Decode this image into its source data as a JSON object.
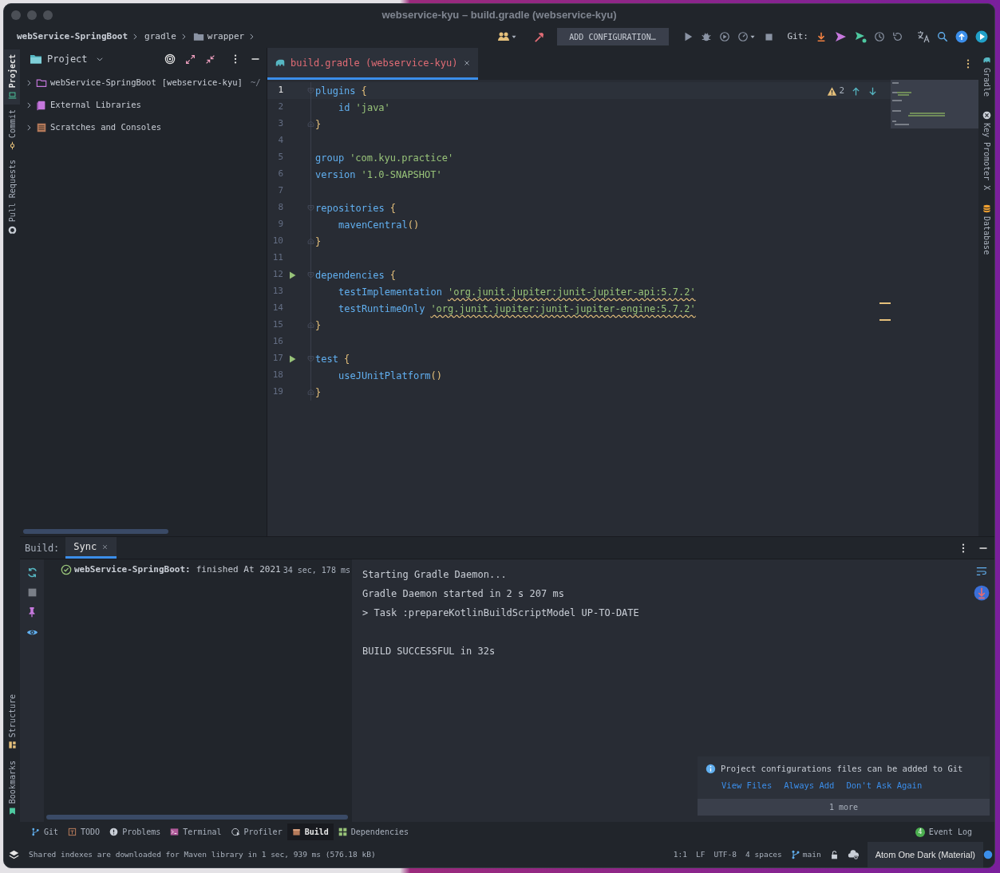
{
  "window": {
    "title": "webservice-kyu – build.gradle (webservice-kyu)"
  },
  "breadcrumbs": [
    {
      "label": "webService-SpringBoot",
      "kind": "project"
    },
    {
      "label": "gradle",
      "kind": "plain"
    },
    {
      "label": "wrapper",
      "kind": "folder"
    }
  ],
  "toolbar": {
    "run_configuration": "ADD CONFIGURATION…",
    "git_label": "Git:"
  },
  "left_stripe": [
    {
      "label": "Project",
      "selected": true
    },
    {
      "label": "Commit",
      "selected": false
    },
    {
      "label": "Pull Requests",
      "selected": false
    }
  ],
  "left_stripe_bottom": [
    {
      "label": "Structure"
    },
    {
      "label": "Bookmarks"
    }
  ],
  "right_stripe": [
    {
      "label": "Gradle"
    },
    {
      "label": "Key Promoter X"
    },
    {
      "label": "Database"
    }
  ],
  "project_panel": {
    "title": "Project",
    "items": [
      {
        "label": "webService-SpringBoot",
        "module": "[webservice-kyu]",
        "path": "~/",
        "kind": "module",
        "expanded": false
      },
      {
        "label": "External Libraries",
        "kind": "libraries",
        "expanded": false
      },
      {
        "label": "Scratches and Consoles",
        "kind": "scratches",
        "expanded": false
      }
    ]
  },
  "editor": {
    "tabs": [
      {
        "label": "build.gradle (webservice-kyu)",
        "selected": true
      }
    ],
    "warning_count": "2",
    "lines": [
      {
        "number": "1",
        "current": true,
        "run": false,
        "fold_start": true,
        "fold_end": false,
        "indented": false,
        "tokens": [
          {
            "kind": "ident",
            "text": "plugins"
          },
          {
            "kind": "brace",
            "text": "{"
          }
        ]
      },
      {
        "number": "2",
        "current": false,
        "run": false,
        "fold_start": false,
        "fold_end": false,
        "indented": true,
        "tokens": [
          {
            "kind": "ident",
            "text": "id"
          },
          {
            "kind": "string",
            "text": "'java'"
          }
        ]
      },
      {
        "number": "3",
        "current": false,
        "run": false,
        "fold_start": false,
        "fold_end": true,
        "indented": false,
        "tokens": [
          {
            "kind": "brace",
            "text": "}"
          }
        ]
      },
      {
        "number": "4",
        "current": false,
        "run": false,
        "fold_start": false,
        "fold_end": false
      },
      {
        "number": "5",
        "current": false,
        "run": false,
        "fold_start": false,
        "fold_end": false,
        "indented": false,
        "tokens": [
          {
            "kind": "ident",
            "text": "group"
          },
          {
            "kind": "string",
            "text": "'com.kyu.practice'"
          }
        ]
      },
      {
        "number": "6",
        "current": false,
        "run": false,
        "fold_start": false,
        "fold_end": false,
        "indented": false,
        "tokens": [
          {
            "kind": "ident",
            "text": "version"
          },
          {
            "kind": "string",
            "text": "'1.0-SNAPSHOT'"
          }
        ]
      },
      {
        "number": "7",
        "current": false,
        "run": false,
        "fold_start": false,
        "fold_end": false
      },
      {
        "number": "8",
        "current": false,
        "run": false,
        "fold_start": true,
        "fold_end": false,
        "indented": false,
        "tokens": [
          {
            "kind": "ident",
            "text": "repositories"
          },
          {
            "kind": "brace",
            "text": "{"
          }
        ]
      },
      {
        "number": "9",
        "current": false,
        "run": false,
        "fold_start": false,
        "fold_end": false,
        "indented": true,
        "tokens": [
          {
            "kind": "call",
            "text": "mavenCentral",
            "parens": "()"
          }
        ]
      },
      {
        "number": "10",
        "current": false,
        "run": false,
        "fold_start": false,
        "fold_end": true,
        "indented": false,
        "tokens": [
          {
            "kind": "brace",
            "text": "}"
          }
        ]
      },
      {
        "number": "11",
        "current": false,
        "run": false,
        "fold_start": false,
        "fold_end": false
      },
      {
        "number": "12",
        "current": false,
        "run": true,
        "fold_start": true,
        "fold_end": false,
        "indented": false,
        "tokens": [
          {
            "kind": "ident",
            "text": "dependencies"
          },
          {
            "kind": "brace",
            "text": "{"
          }
        ]
      },
      {
        "number": "13",
        "current": false,
        "run": false,
        "fold_start": false,
        "fold_end": false,
        "indented": true,
        "tokens": [
          {
            "kind": "ident",
            "text": "testImplementation"
          },
          {
            "kind": "string_warn",
            "text": "'org.junit.jupiter:junit-jupiter-api:5.7.2'"
          }
        ]
      },
      {
        "number": "14",
        "current": false,
        "run": false,
        "fold_start": false,
        "fold_end": false,
        "indented": true,
        "tokens": [
          {
            "kind": "ident",
            "text": "testRuntimeOnly"
          },
          {
            "kind": "string_warn",
            "text": "'org.junit.jupiter:junit-jupiter-engine:5.7.2'"
          }
        ]
      },
      {
        "number": "15",
        "current": false,
        "run": false,
        "fold_start": false,
        "fold_end": true,
        "indented": false,
        "tokens": [
          {
            "kind": "brace",
            "text": "}"
          }
        ]
      },
      {
        "number": "16",
        "current": false,
        "run": false,
        "fold_start": false,
        "fold_end": false
      },
      {
        "number": "17",
        "current": false,
        "run": true,
        "fold_start": true,
        "fold_end": false,
        "indented": false,
        "tokens": [
          {
            "kind": "ident",
            "text": "test"
          },
          {
            "kind": "brace",
            "text": "{"
          }
        ]
      },
      {
        "number": "18",
        "current": false,
        "run": false,
        "fold_start": false,
        "fold_end": false,
        "indented": true,
        "tokens": [
          {
            "kind": "call",
            "text": "useJUnitPlatform",
            "parens": "()"
          }
        ]
      },
      {
        "number": "19",
        "current": false,
        "run": false,
        "fold_start": false,
        "fold_end": true,
        "indented": false,
        "tokens": [
          {
            "kind": "brace",
            "text": "}"
          }
        ]
      }
    ]
  },
  "build_panel": {
    "label": "Build:",
    "tabs": [
      {
        "label": "Sync",
        "selected": true
      }
    ],
    "tree": [
      {
        "name": "webService-SpringBoot:",
        "status": "finished At 2021",
        "duration": "34 sec, 178 ms"
      }
    ],
    "console": [
      {
        "text": "Starting Gradle Daemon...",
        "kind": "log"
      },
      {
        "text": "Gradle Daemon started in 2 s 207 ms",
        "kind": "log"
      },
      {
        "text": "> Task :prepareKotlinBuildScriptModel UP-TO-DATE",
        "kind": "log"
      },
      {
        "text": "BUILD SUCCESSFUL in 32s",
        "kind": "result"
      }
    ]
  },
  "notification": {
    "text": "Project configurations files can be added to Git",
    "actions": [
      "View Files",
      "Always Add",
      "Don't Ask Again"
    ],
    "more": "1 more"
  },
  "tool_windows": [
    {
      "label": "Git",
      "kind": "git",
      "selected": false
    },
    {
      "label": "TODO",
      "kind": "todo",
      "selected": false
    },
    {
      "label": "Problems",
      "kind": "problems",
      "selected": false
    },
    {
      "label": "Terminal",
      "kind": "terminal",
      "selected": false
    },
    {
      "label": "Profiler",
      "kind": "profiler",
      "selected": false
    },
    {
      "label": "Build",
      "kind": "build",
      "selected": true
    },
    {
      "label": "Dependencies",
      "kind": "dependencies",
      "selected": false
    }
  ],
  "event_log": {
    "label": "Event Log",
    "badge": "4"
  },
  "status_bar": {
    "message": "Shared indexes are downloaded for Maven library in 1 sec, 939 ms (576.18 kB)",
    "items": [
      "1:1",
      "LF",
      "UTF-8",
      "4 spaces"
    ],
    "branch": "main",
    "theme": "Atom One Dark (Material)"
  }
}
